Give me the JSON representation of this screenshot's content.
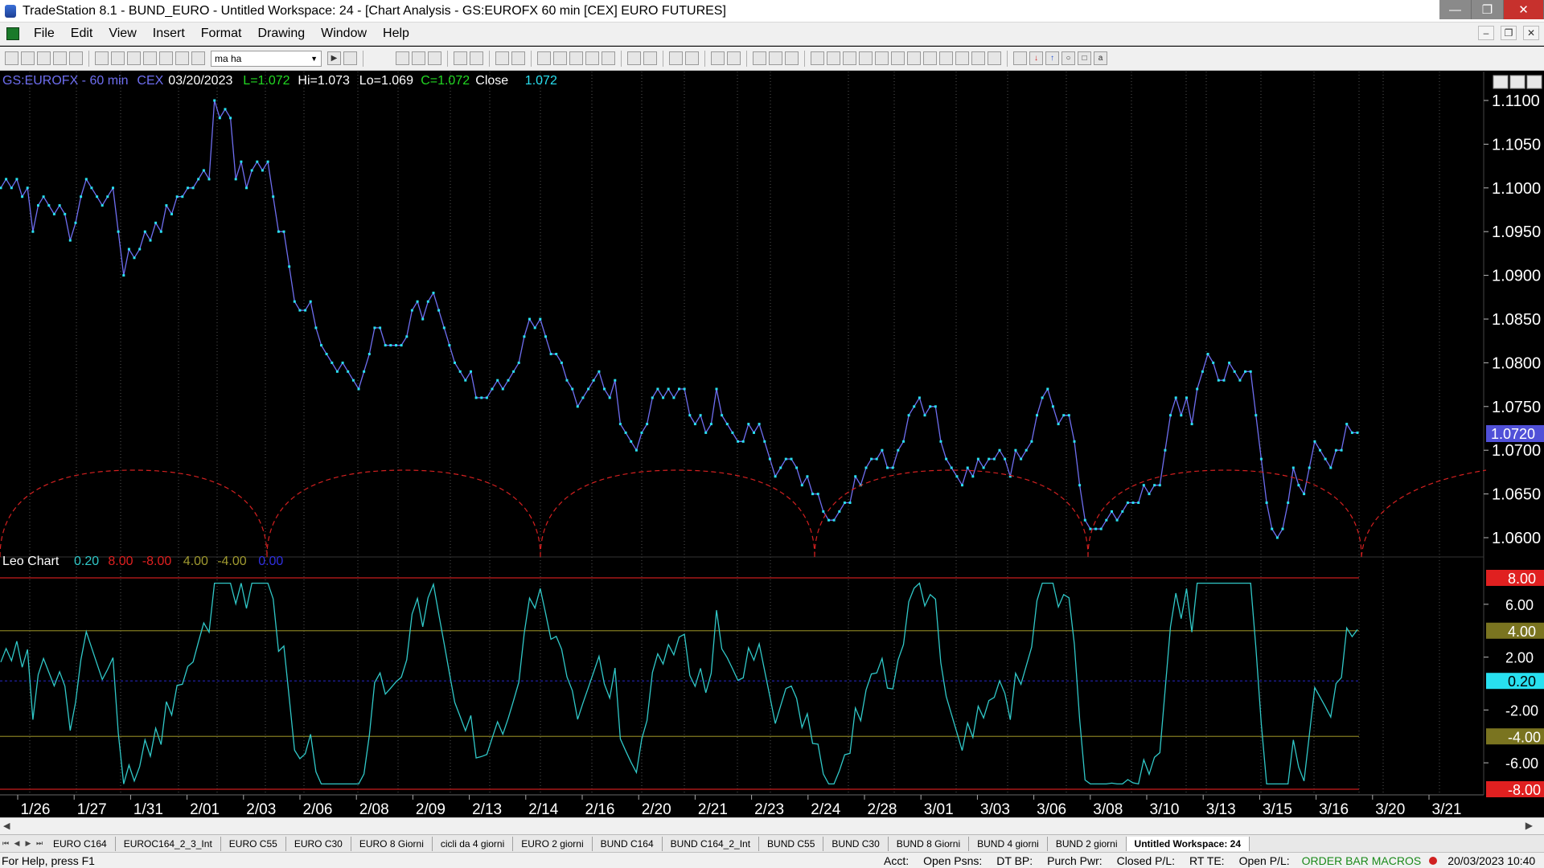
{
  "window": {
    "title": "TradeStation 8.1 - BUND_EURO - Untitled Workspace:  24 - [Chart Analysis - GS:EUROFX  60 min  [CEX] EURO FUTURES]",
    "controls": [
      "—",
      "❐",
      "✕"
    ]
  },
  "menu": {
    "items": [
      "File",
      "Edit",
      "View",
      "Insert",
      "Format",
      "Drawing",
      "Window",
      "Help"
    ],
    "mdi_controls": [
      "–",
      "❐",
      "✕"
    ]
  },
  "toolbar": {
    "symbol_value": "ma ha"
  },
  "chart": {
    "header": {
      "symbol": "GS:EUROFX - 60 min",
      "exchange": "CEX",
      "date": "03/20/2023",
      "low_label": "L=1.072",
      "high_label": "Hi=1.073",
      "lo_label": "Lo=1.069",
      "close_label": "C=1.072",
      "close_word": "Close",
      "close_value": "1.072"
    },
    "price_axis_labels": [
      "1.1100",
      "1.1050",
      "1.1000",
      "1.0950",
      "1.0900",
      "1.0850",
      "1.0800",
      "1.0750",
      "1.0700",
      "1.0650",
      "1.0600"
    ],
    "last_price_box": "1.0720",
    "indicator_header": {
      "name": "Leo Chart",
      "values": [
        "0.20",
        "8.00",
        "-8.00",
        "4.00",
        "-4.00",
        "0.00"
      ]
    },
    "indicator_axis_labels": [
      "6.00",
      "2.00",
      "-2.00",
      "-6.00"
    ],
    "indicator_boxes": [
      "8.00",
      "4.00",
      "0.20",
      "-4.00",
      "-8.00"
    ],
    "date_labels": [
      "1/26",
      "1/27",
      "1/31",
      "2/01",
      "2/03",
      "2/06",
      "2/08",
      "2/09",
      "2/13",
      "2/14",
      "2/16",
      "2/20",
      "2/21",
      "2/23",
      "2/24",
      "2/28",
      "3/01",
      "3/03",
      "3/06",
      "3/08",
      "3/10",
      "3/13",
      "3/15",
      "3/16",
      "3/20",
      "3/21"
    ],
    "colors": {
      "price_line": "#6e6ef0",
      "price_dots": "#28e0f0",
      "cycle_line": "#d42020",
      "indicator_line": "#30c8c8",
      "level_8": "#c81e1e",
      "level_4": "#807a20",
      "level_0": "#2020a0"
    }
  },
  "tabs": [
    "EURO C164",
    "EUROC164_2_3_Int",
    "EURO C55",
    "EURO C30",
    "EURO 8 Giorni",
    "cicli da 4 giorni",
    "EURO 2 giorni",
    "BUND C164",
    "BUND C164_2_Int",
    "BUND C55",
    "BUND  C30",
    "BUND 8 Giorni",
    "BUND 4 giorni",
    "BUND 2 giorni",
    "Untitled Workspace:  24"
  ],
  "status": {
    "help": "For Help, press F1",
    "fields": [
      "Acct:",
      "Open Psns:",
      "DT BP:",
      "Purch Pwr:",
      "Closed P/L:",
      "RT TE:",
      "Open P/L:"
    ],
    "order_bar": "ORDER BAR  MACROS",
    "datetime": "20/03/2023 10:40"
  }
}
